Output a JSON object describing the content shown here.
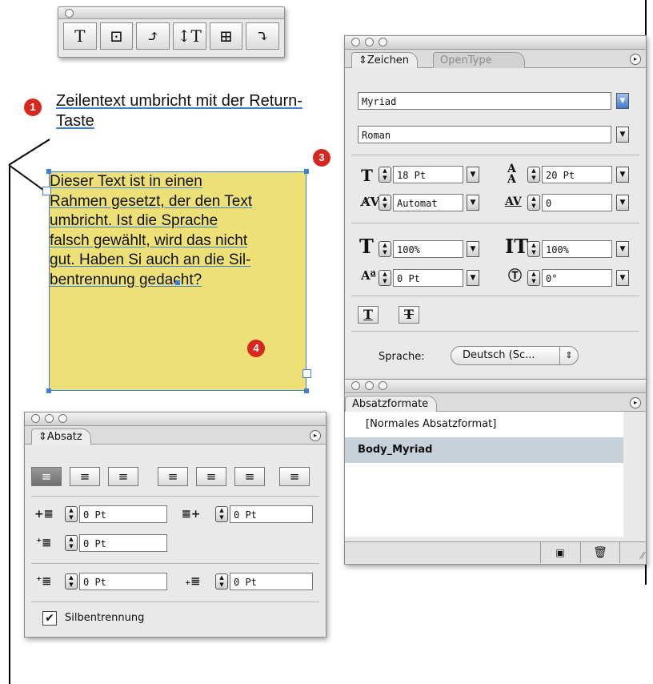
{
  "toolbar": {
    "tools": [
      {
        "icon": "type-tool-icon",
        "glyph": "T"
      },
      {
        "icon": "frame-type-tool-icon",
        "glyph": "⊡"
      },
      {
        "icon": "type-on-path-icon",
        "glyph": "⤴"
      },
      {
        "icon": "vertical-type-tool-icon",
        "glyph": "↕T"
      },
      {
        "icon": "vertical-frame-type-icon",
        "glyph": "⊞"
      },
      {
        "icon": "vertical-path-type-icon",
        "glyph": "⤵"
      }
    ]
  },
  "callouts": {
    "c1": "1",
    "c3": "3",
    "c4": "4",
    "heading": "Zeilentext umbricht mit der Return-Taste",
    "frame_text": "Dieser Text ist in einen Rahmen gesetzt, der den Text umbricht. Ist die Sprache falsch gewählt, wird das nicht gut. Haben Si auch an die Silbentrennung gedacht?",
    "frame_lines": [
      "Dieser Text ist in einen",
      "Rahmen gesetzt, der den Text",
      "umbricht. Ist die Sprache",
      "falsch gewählt, wird das nicht",
      "gut. Haben Si auch an die Sil-",
      "bentrennung gedacht?"
    ]
  },
  "zeichen": {
    "tab_active": "Zeichen",
    "tab_inactive": "OpenType",
    "font_family": "Myriad",
    "font_style": "Roman",
    "font_size": "18 Pt",
    "leading": "20 Pt",
    "kerning": "Automat",
    "tracking": "0",
    "vertical_scale": "100%",
    "horizontal_scale": "100%",
    "baseline_shift": "0 Pt",
    "skew": "0°",
    "language_label": "Sprache:",
    "language_value": "Deutsch (Sc..."
  },
  "absatzformate": {
    "tab": "Absatzformate",
    "items": [
      "[Normales Absatzformat]",
      "Body_Myriad"
    ],
    "selected_index": 1
  },
  "absatz": {
    "tab": "Absatz",
    "left_indent": "0 Pt",
    "right_indent": "0 Pt",
    "first_line_indent": "0 Pt",
    "space_before": "0 Pt",
    "space_after": "0 Pt",
    "hyphenation_label": "Silbentrennung",
    "hyphenation_checked": true
  },
  "colors": {
    "frame_fill": "#ede077",
    "badge": "#d6281e",
    "selection": "#3c7fd7",
    "list_selected": "#c7d1da"
  }
}
